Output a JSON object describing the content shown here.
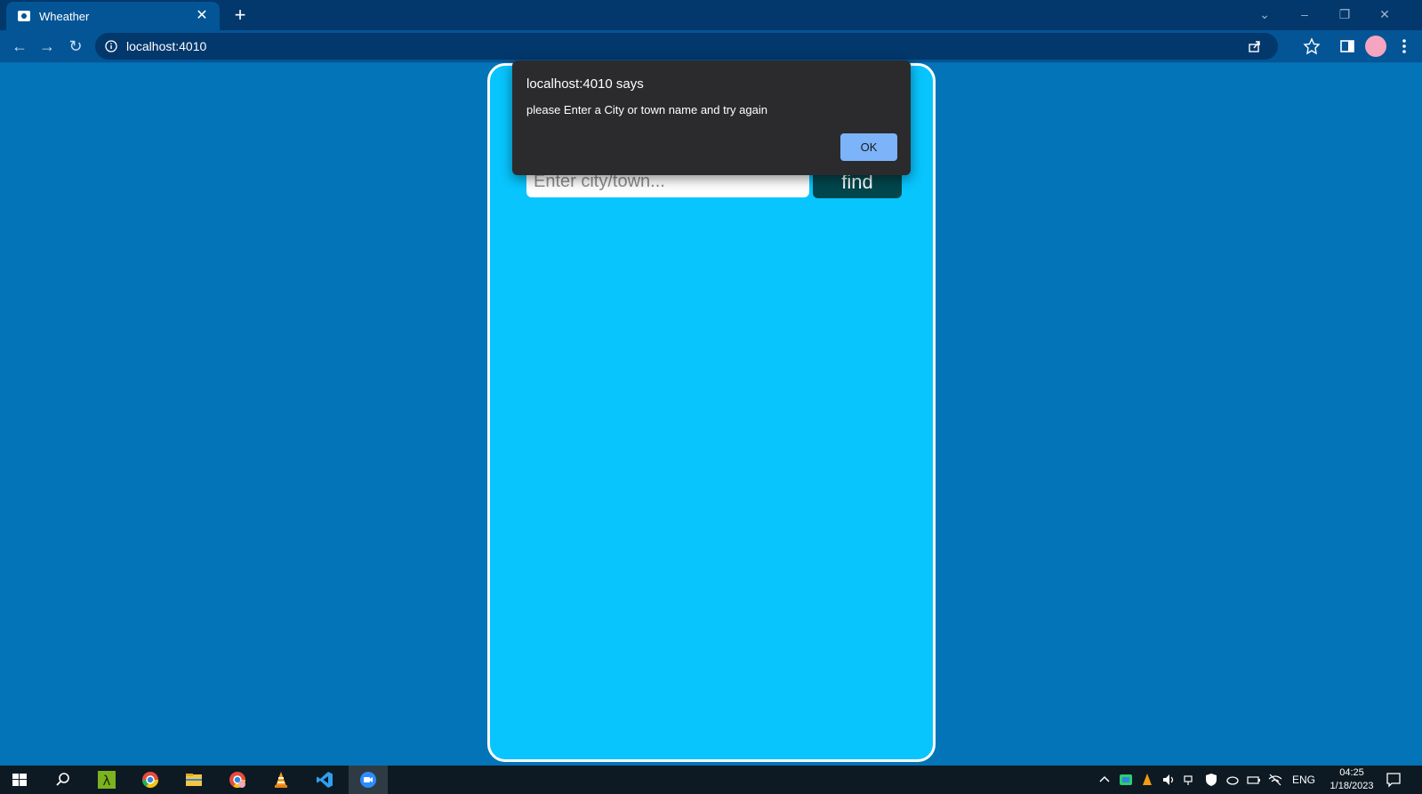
{
  "browser": {
    "tab_title": "Wheather",
    "url": "localhost:4010"
  },
  "app": {
    "search_placeholder": "Enter city/town...",
    "search_value": "",
    "find_label": "find"
  },
  "alert": {
    "title": "localhost:4010 says",
    "message": "please Enter a City or town name and try again",
    "ok_label": "OK"
  },
  "taskbar": {
    "language": "ENG",
    "time": "04:25",
    "date": "1/18/2023",
    "pinned": [
      "windows-start",
      "search",
      "lambda-app",
      "chrome",
      "file-explorer",
      "chrome-profile",
      "vlc",
      "vscode",
      "zoom"
    ]
  },
  "colors": {
    "page_bg": "#0374b8",
    "card_bg": "#08c5fe",
    "find_button": "#00474d",
    "ok_button": "#7cb3f9"
  }
}
